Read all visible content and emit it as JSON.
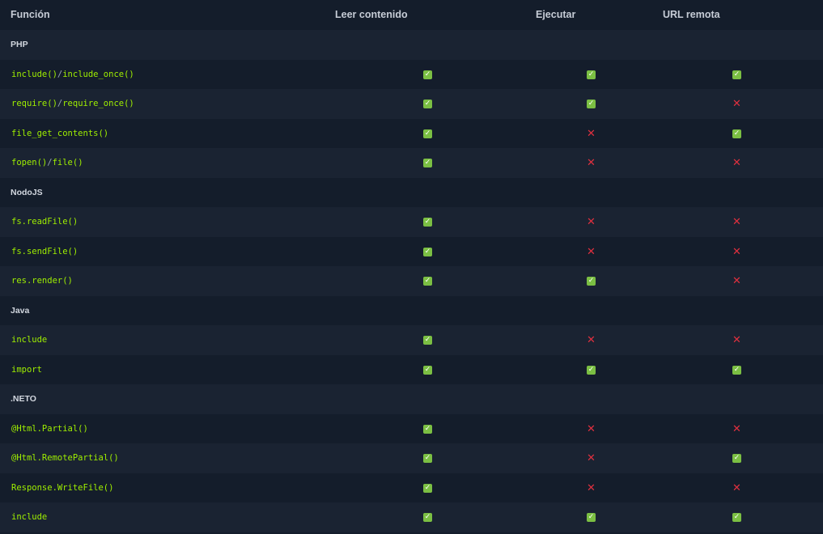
{
  "header": {
    "col_function": "Función",
    "col_read": "Leer contenido",
    "col_execute": "Ejecutar",
    "col_remote": "URL remota"
  },
  "icons": {
    "yes": "check-mark-icon",
    "no": "cross-mark-icon",
    "yes_glyph": "✓",
    "no_glyph": "✕"
  },
  "colors": {
    "function_text": "#9fef00",
    "yes": "#7bbf43",
    "no": "#e0303f",
    "background": "#141d2b",
    "stripe": "#1a2332"
  },
  "sections": [
    {
      "name": "PHP",
      "rows": [
        {
          "fn": [
            "include()",
            "include_once()"
          ],
          "read": true,
          "execute": true,
          "remote": true
        },
        {
          "fn": [
            "require()",
            "require_once()"
          ],
          "read": true,
          "execute": true,
          "remote": false
        },
        {
          "fn": [
            "file_get_contents()"
          ],
          "read": true,
          "execute": false,
          "remote": true
        },
        {
          "fn": [
            "fopen()",
            "file()"
          ],
          "read": true,
          "execute": false,
          "remote": false
        }
      ]
    },
    {
      "name": "NodoJS",
      "rows": [
        {
          "fn": [
            "fs.readFile()"
          ],
          "read": true,
          "execute": false,
          "remote": false
        },
        {
          "fn": [
            "fs.sendFile()"
          ],
          "read": true,
          "execute": false,
          "remote": false
        },
        {
          "fn": [
            "res.render()"
          ],
          "read": true,
          "execute": true,
          "remote": false
        }
      ]
    },
    {
      "name": "Java",
      "rows": [
        {
          "fn": [
            "include"
          ],
          "read": true,
          "execute": false,
          "remote": false
        },
        {
          "fn": [
            "import"
          ],
          "read": true,
          "execute": true,
          "remote": true
        }
      ]
    },
    {
      "name": ".NETO",
      "rows": [
        {
          "fn": [
            "@Html.Partial()"
          ],
          "read": true,
          "execute": false,
          "remote": false
        },
        {
          "fn": [
            "@Html.RemotePartial()"
          ],
          "read": true,
          "execute": false,
          "remote": true
        },
        {
          "fn": [
            "Response.WriteFile()"
          ],
          "read": true,
          "execute": false,
          "remote": false
        },
        {
          "fn": [
            "include"
          ],
          "read": true,
          "execute": true,
          "remote": true
        }
      ]
    }
  ]
}
